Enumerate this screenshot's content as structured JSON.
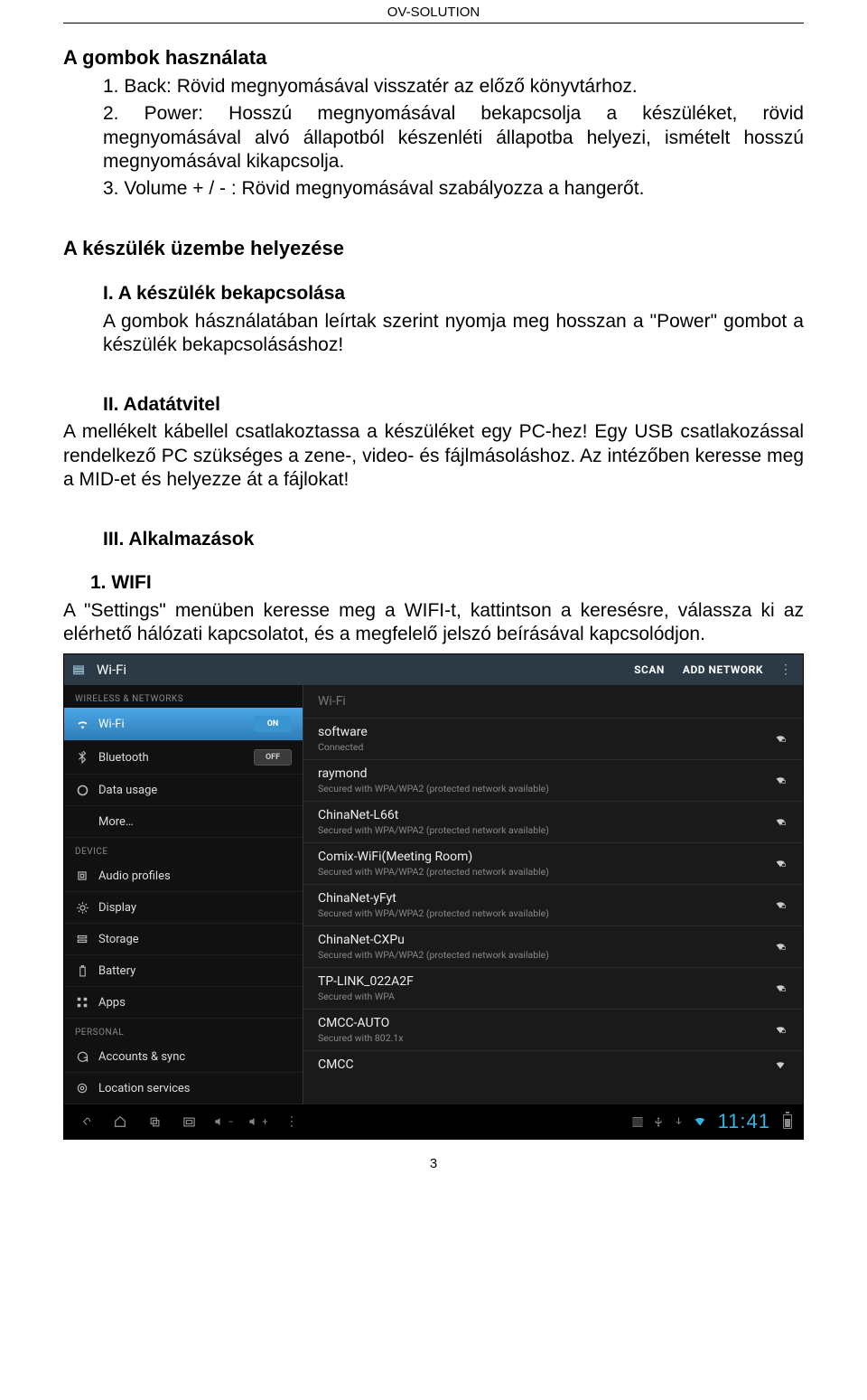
{
  "header": "OV-SOLUTION",
  "page_number": "3",
  "doc": {
    "h_buttons": "A gombok használata",
    "li1": "1. Back: Rövid megnyomásával visszatér az előző könyvtárhoz.",
    "li2": "2. Power: Hosszú megnyomásával bekapcsolja a készüléket, rövid megnyomásával alvó állapotból készenléti állapotba helyezi, ismételt hosszú megnyomásával kikapcsolja.",
    "li3": "3. Volume + / - : Rövid megnyomásával szabályozza a hangerőt.",
    "h_setup": "A készülék üzembe helyezése",
    "i1_title": "I.    A készülék bekapcsolása",
    "i1_body": "A gombok hásználatában leírtak szerint nyomja meg hosszan a \"Power\" gombot a készülék bekapcsolásáshoz!",
    "i2_title": "II.    Adatátvitel",
    "i2_body": "A mellékelt kábellel csatlakoztassa a készüléket egy PC-hez! Egy USB csatlakozással rendelkező PC szükséges a zene-, video- és fájlmásoláshoz. Az intézőben keresse meg a MID-et és helyezze át a fájlokat!",
    "i3_title": "III. Alkalmazások",
    "wifi_title": "1. WIFI",
    "wifi_body": "A \"Settings\" menüben keresse meg a WIFI-t, kattintson a keresésre, válassza ki az elérhető hálózati kapcsolatot, és a megfelelő jelszó beírásával kapcsolódjon."
  },
  "screenshot": {
    "title": "Wi-Fi",
    "scan": "SCAN",
    "add": "ADD NETWORK",
    "main_header": "Wi-Fi",
    "sidebar": {
      "sec1": "WIRELESS & NETWORKS",
      "wifi": "Wi-Fi",
      "wifi_toggle": "ON",
      "bt": "Bluetooth",
      "bt_toggle": "OFF",
      "data": "Data usage",
      "more": "More…",
      "sec2": "DEVICE",
      "audio": "Audio profiles",
      "display": "Display",
      "storage": "Storage",
      "battery": "Battery",
      "apps": "Apps",
      "sec3": "PERSONAL",
      "accounts": "Accounts & sync",
      "location": "Location services"
    },
    "networks": [
      {
        "ssid": "software",
        "sub": "Connected",
        "locked": true
      },
      {
        "ssid": "raymond",
        "sub": "Secured with WPA/WPA2 (protected network available)",
        "locked": true
      },
      {
        "ssid": "ChinaNet-L66t",
        "sub": "Secured with WPA/WPA2 (protected network available)",
        "locked": true
      },
      {
        "ssid": "Comix-WiFi(Meeting Room)",
        "sub": "Secured with WPA/WPA2 (protected network available)",
        "locked": true
      },
      {
        "ssid": "ChinaNet-yFyt",
        "sub": "Secured with WPA/WPA2 (protected network available)",
        "locked": true
      },
      {
        "ssid": "ChinaNet-CXPu",
        "sub": "Secured with WPA/WPA2 (protected network available)",
        "locked": true
      },
      {
        "ssid": "TP-LINK_022A2F",
        "sub": "Secured with WPA",
        "locked": true
      },
      {
        "ssid": "CMCC-AUTO",
        "sub": "Secured with 802.1x",
        "locked": true
      },
      {
        "ssid": "CMCC",
        "sub": "",
        "locked": false
      }
    ],
    "clock": "11:41"
  }
}
